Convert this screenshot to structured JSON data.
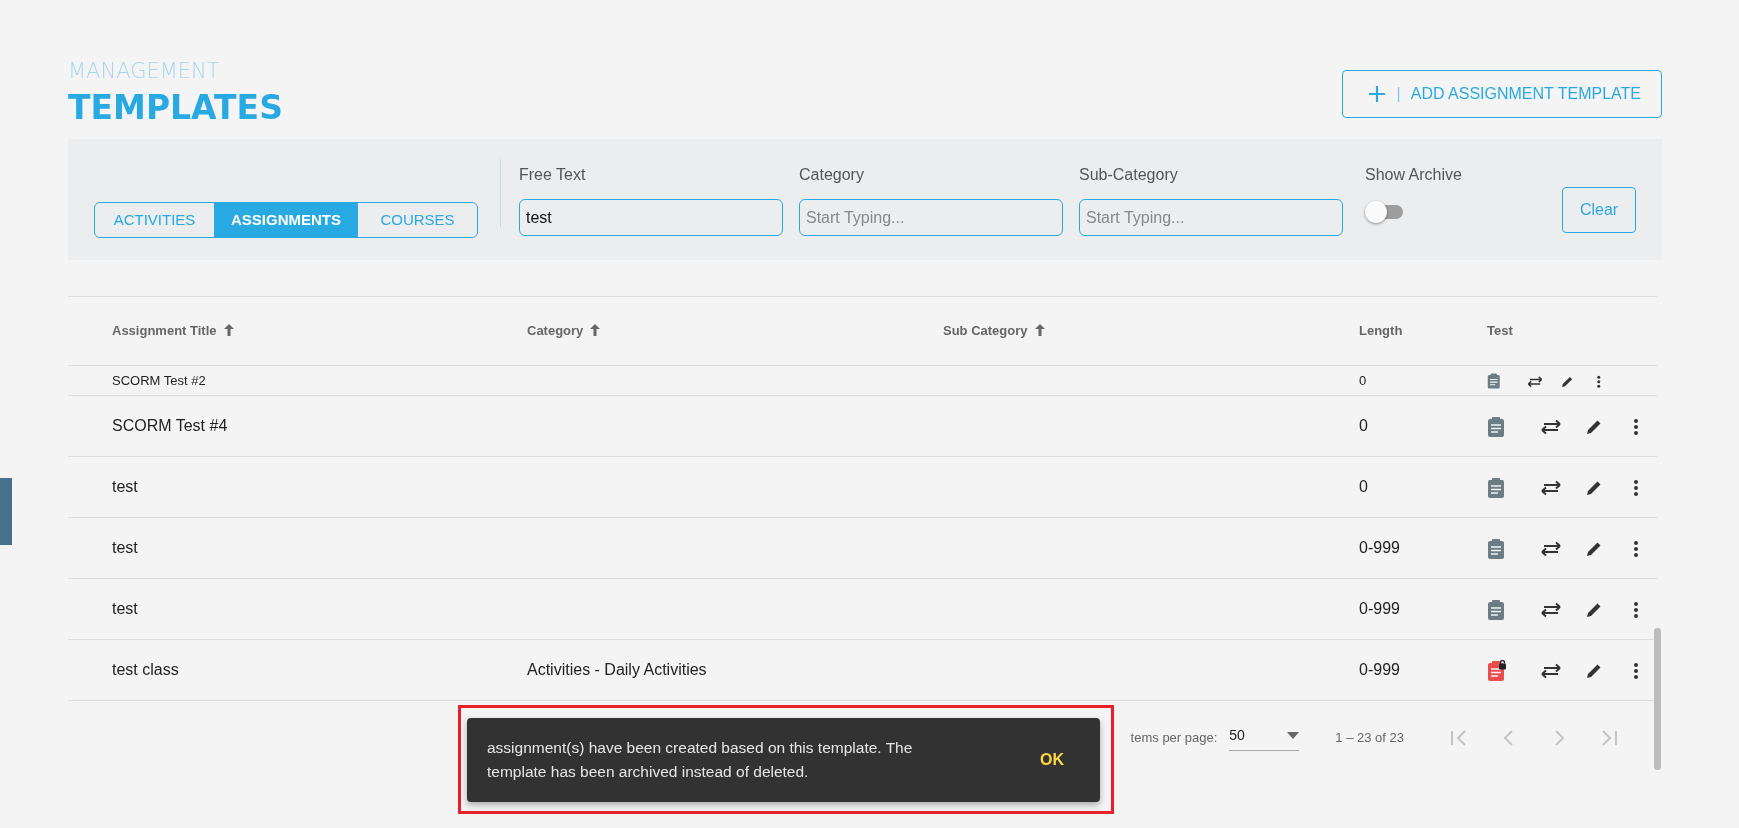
{
  "header": {
    "section": "MANAGEMENT",
    "title": "TEMPLATES",
    "add_button": {
      "separator": "|",
      "label": "ADD ASSIGNMENT TEMPLATE"
    }
  },
  "filters": {
    "tabs": [
      {
        "label": "ACTIVITIES",
        "selected": false
      },
      {
        "label": "ASSIGNMENTS",
        "selected": true
      },
      {
        "label": "COURSES",
        "selected": false
      }
    ],
    "fields": [
      {
        "label": "Free Text",
        "value": "test"
      },
      {
        "label": "Category",
        "placeholder": "Start Typing..."
      },
      {
        "label": "Sub-Category",
        "placeholder": "Start Typing..."
      }
    ],
    "show_archive": {
      "label": "Show Archive",
      "on": false
    },
    "clear_button": "Clear"
  },
  "table": {
    "columns": [
      {
        "label": "Assignment Title",
        "sortable": true
      },
      {
        "label": "Category",
        "sortable": true
      },
      {
        "label": "Sub Category",
        "sortable": true
      },
      {
        "label": "Length",
        "sortable": false
      },
      {
        "label": "Test",
        "sortable": false
      }
    ],
    "rows": [
      {
        "title": "SCORM Test #2",
        "category": "",
        "sub_category": "",
        "length": "0",
        "locked": false,
        "partial": true
      },
      {
        "title": "SCORM Test #4",
        "category": "",
        "sub_category": "",
        "length": "0",
        "locked": false,
        "partial": false
      },
      {
        "title": "test",
        "category": "",
        "sub_category": "",
        "length": "0",
        "locked": false,
        "partial": false
      },
      {
        "title": "test",
        "category": "",
        "sub_category": "",
        "length": "0-999",
        "locked": false,
        "partial": false
      },
      {
        "title": "test",
        "category": "",
        "sub_category": "",
        "length": "0-999",
        "locked": false,
        "partial": false
      },
      {
        "title": "test class",
        "category": "Activities - Daily Activities",
        "sub_category": "",
        "length": "0-999",
        "locked": true,
        "partial": false
      }
    ]
  },
  "paginator": {
    "items_per_page_label": "tems per page:",
    "page_size": "50",
    "range": "1 – 23 of 23",
    "nav": [
      {
        "kind": "first",
        "disabled": true
      },
      {
        "kind": "prev",
        "disabled": true
      },
      {
        "kind": "next",
        "disabled": true
      },
      {
        "kind": "last",
        "disabled": true
      }
    ]
  },
  "snackbar": {
    "message": "assignment(s) have been created based on this template. The template has been archived instead of deleted.",
    "action": "OK",
    "highlighted": true
  }
}
